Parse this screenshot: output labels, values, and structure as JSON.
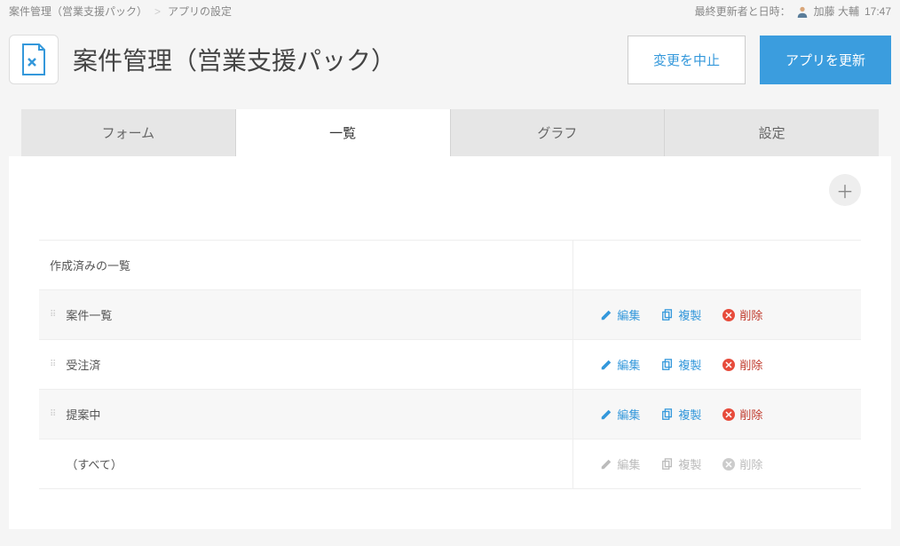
{
  "breadcrumb": {
    "app_link": "案件管理（営業支援パック）",
    "sep": ">",
    "current": "アプリの設定"
  },
  "last_update": {
    "label": "最終更新者と日時：",
    "user": "加藤 大輔",
    "time": "17:47"
  },
  "header": {
    "title": "案件管理（営業支援パック）",
    "cancel_label": "変更を中止",
    "update_label": "アプリを更新"
  },
  "tabs": {
    "form": "フォーム",
    "list": "一覧",
    "graph": "グラフ",
    "settings": "設定"
  },
  "list_section": {
    "header": "作成済みの一覧",
    "actions": {
      "edit": "編集",
      "copy": "複製",
      "delete": "削除"
    },
    "rows": [
      {
        "name": "案件一覧",
        "draggable": true,
        "editable": true
      },
      {
        "name": "受注済",
        "draggable": true,
        "editable": true
      },
      {
        "name": "提案中",
        "draggable": true,
        "editable": true
      },
      {
        "name": "（すべて）",
        "draggable": false,
        "editable": false
      }
    ]
  }
}
